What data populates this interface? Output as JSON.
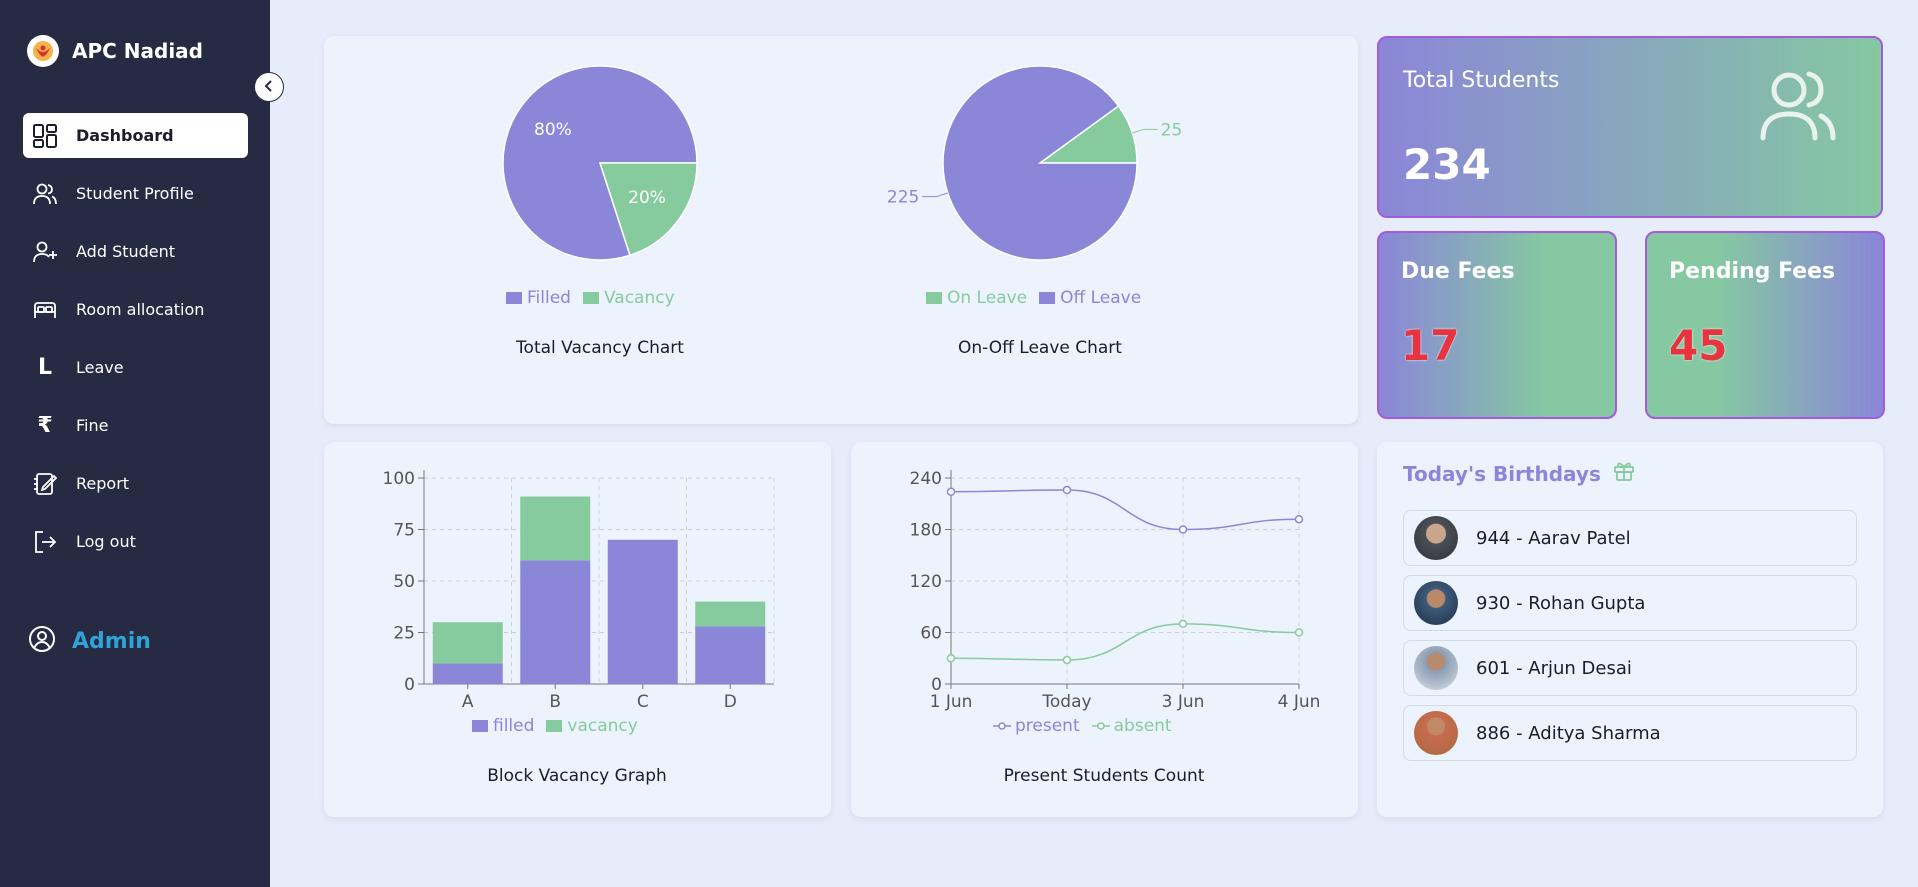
{
  "brand": {
    "name": "APC Nadiad"
  },
  "sidebar": {
    "items": [
      {
        "label": "Dashboard",
        "icon": "dashboard-icon",
        "active": true
      },
      {
        "label": "Student Profile",
        "icon": "users-icon"
      },
      {
        "label": "Add Student",
        "icon": "user-plus-icon"
      },
      {
        "label": "Room allocation",
        "icon": "bed-icon"
      },
      {
        "label": "Leave",
        "icon": "letter-l-icon"
      },
      {
        "label": "Fine",
        "icon": "rupee-icon"
      },
      {
        "label": "Report",
        "icon": "report-icon"
      },
      {
        "label": "Log out",
        "icon": "logout-icon"
      }
    ],
    "icon_glyphs": {
      "leave": "L",
      "fine": "₹"
    },
    "admin_label": "Admin"
  },
  "colors": {
    "purple": "#8a86d8",
    "green": "#86cb9e",
    "sidebar_bg": "#262a42",
    "admin_blue": "#2ea3d8",
    "red": "#e8343f"
  },
  "stats": {
    "total_students": {
      "title": "Total Students",
      "value": "234"
    },
    "due_fees": {
      "title": "Due Fees",
      "value": "17"
    },
    "pending_fees": {
      "title": "Pending Fees",
      "value": "45"
    }
  },
  "birthdays": {
    "title": "Today's Birthdays",
    "items": [
      {
        "label": "944 - Aarav Patel"
      },
      {
        "label": "930 - Rohan Gupta"
      },
      {
        "label": "601 - Arjun Desai"
      },
      {
        "label": "886 - Aditya Sharma"
      }
    ]
  },
  "chart_data": [
    {
      "type": "pie",
      "title": "Total Vacancy Chart",
      "slices": [
        {
          "name": "Filled",
          "value": 80,
          "label": "80%",
          "color": "#8a86d8"
        },
        {
          "name": "Vacancy",
          "value": 20,
          "label": "20%",
          "color": "#86cb9e"
        }
      ],
      "legend": "bottom"
    },
    {
      "type": "pie",
      "title": "On-Off Leave Chart",
      "slices": [
        {
          "name": "On Leave",
          "value": 25,
          "label": "25",
          "color": "#86cb9e"
        },
        {
          "name": "Off Leave",
          "value": 225,
          "label": "225",
          "color": "#8a86d8"
        }
      ],
      "legend": "bottom"
    },
    {
      "type": "bar",
      "title": "Block Vacancy Graph",
      "stacked": true,
      "categories": [
        "A",
        "B",
        "C",
        "D"
      ],
      "series": [
        {
          "name": "filled",
          "values": [
            10,
            60,
            70,
            28
          ],
          "color": "#8a86d8"
        },
        {
          "name": "vacancy",
          "values": [
            20,
            31,
            0,
            12
          ],
          "color": "#86cb9e"
        }
      ],
      "yticks": [
        "0",
        "25",
        "50",
        "75",
        "100"
      ],
      "ylim": [
        0,
        100
      ],
      "grid": true,
      "legend": "bottom"
    },
    {
      "type": "line",
      "title": "Present Students Count",
      "categories": [
        "1 Jun",
        "Today",
        "3 Jun",
        "4 Jun"
      ],
      "series": [
        {
          "name": "present",
          "values": [
            224,
            226,
            180,
            192
          ],
          "color": "#8a86d8"
        },
        {
          "name": "absent",
          "values": [
            30,
            28,
            70,
            60
          ],
          "color": "#86cb9e"
        }
      ],
      "yticks": [
        "0",
        "60",
        "120",
        "180",
        "240"
      ],
      "ylim": [
        0,
        240
      ],
      "grid": true,
      "legend": "bottom"
    }
  ]
}
